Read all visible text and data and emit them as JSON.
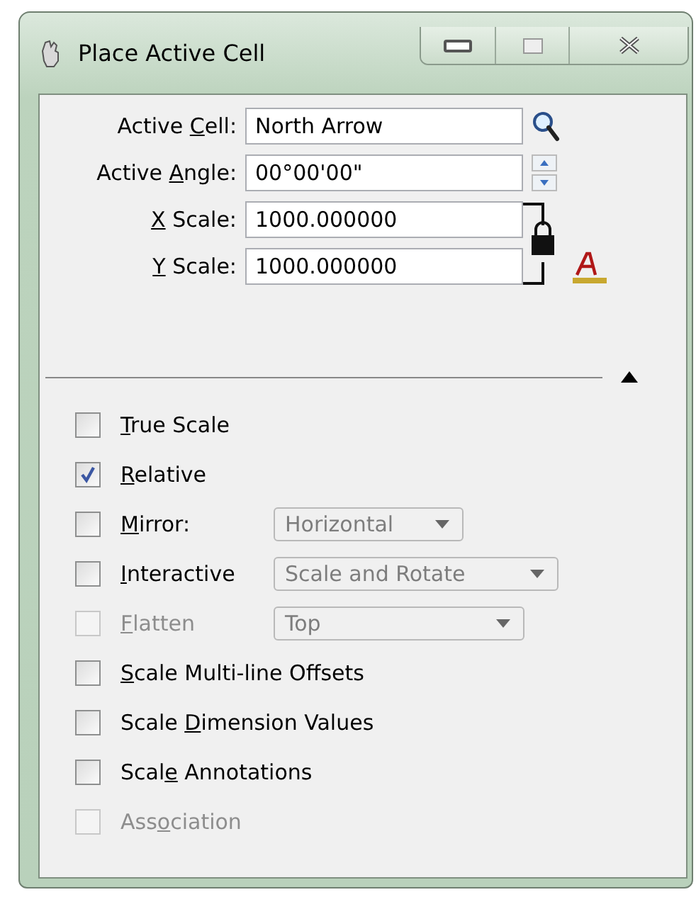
{
  "window": {
    "title": "Place Active Cell"
  },
  "fields": [
    {
      "label": [
        {
          "text": "Active ",
          "underline": false
        },
        {
          "text": "C",
          "underline": true
        },
        {
          "text": "ell:",
          "underline": false
        }
      ],
      "value": "North Arrow",
      "kind": "search"
    },
    {
      "label": [
        {
          "text": "Active ",
          "underline": false
        },
        {
          "text": "A",
          "underline": true
        },
        {
          "text": "ngle:",
          "underline": false
        }
      ],
      "value": "00°00'00\"",
      "kind": "spin"
    },
    {
      "label": [
        {
          "text": "X",
          "underline": true
        },
        {
          "text": " Scale:",
          "underline": false
        }
      ],
      "value": "1000.000000",
      "kind": "scale"
    },
    {
      "label": [
        {
          "text": "Y",
          "underline": true
        },
        {
          "text": " Scale:",
          "underline": false
        }
      ],
      "value": "1000.000000",
      "kind": "scale"
    }
  ],
  "options": [
    {
      "kind": "check",
      "label": [
        {
          "text": "T",
          "underline": true
        },
        {
          "text": "rue Scale",
          "underline": false
        }
      ],
      "checked": false,
      "disabled": false
    },
    {
      "kind": "check",
      "label": [
        {
          "text": "R",
          "underline": true
        },
        {
          "text": "elative",
          "underline": false
        }
      ],
      "checked": true,
      "disabled": false
    },
    {
      "kind": "dropdown",
      "label": [
        {
          "text": "M",
          "underline": true
        },
        {
          "text": "irror:",
          "underline": false
        }
      ],
      "checked": false,
      "disabled": false,
      "dropdown": {
        "value": "Horizontal",
        "disabled": true
      }
    },
    {
      "kind": "dropdown",
      "label": [
        {
          "text": "I",
          "underline": true
        },
        {
          "text": "nteractive",
          "underline": false
        }
      ],
      "checked": false,
      "disabled": false,
      "dropdown": {
        "value": "Scale and Rotate",
        "disabled": true
      }
    },
    {
      "kind": "dropdown",
      "label": [
        {
          "text": "F",
          "underline": true
        },
        {
          "text": "latten",
          "underline": false
        }
      ],
      "checked": false,
      "disabled": true,
      "dropdown": {
        "value": "Top",
        "disabled": true
      }
    },
    {
      "kind": "check",
      "label": [
        {
          "text": "S",
          "underline": true
        },
        {
          "text": "cale Multi-line Offsets",
          "underline": false
        }
      ],
      "checked": false,
      "disabled": false
    },
    {
      "kind": "check",
      "label": [
        {
          "text": "Scale ",
          "underline": false
        },
        {
          "text": "D",
          "underline": true
        },
        {
          "text": "imension Values",
          "underline": false
        }
      ],
      "checked": false,
      "disabled": false
    },
    {
      "kind": "check",
      "label": [
        {
          "text": "Scal",
          "underline": false
        },
        {
          "text": "e",
          "underline": true
        },
        {
          "text": " Annotations",
          "underline": false
        }
      ],
      "checked": false,
      "disabled": false
    },
    {
      "kind": "check",
      "label": [
        {
          "text": "Ass",
          "underline": false
        },
        {
          "text": "o",
          "underline": true
        },
        {
          "text": "ciation",
          "underline": false
        }
      ],
      "checked": false,
      "disabled": true
    }
  ]
}
